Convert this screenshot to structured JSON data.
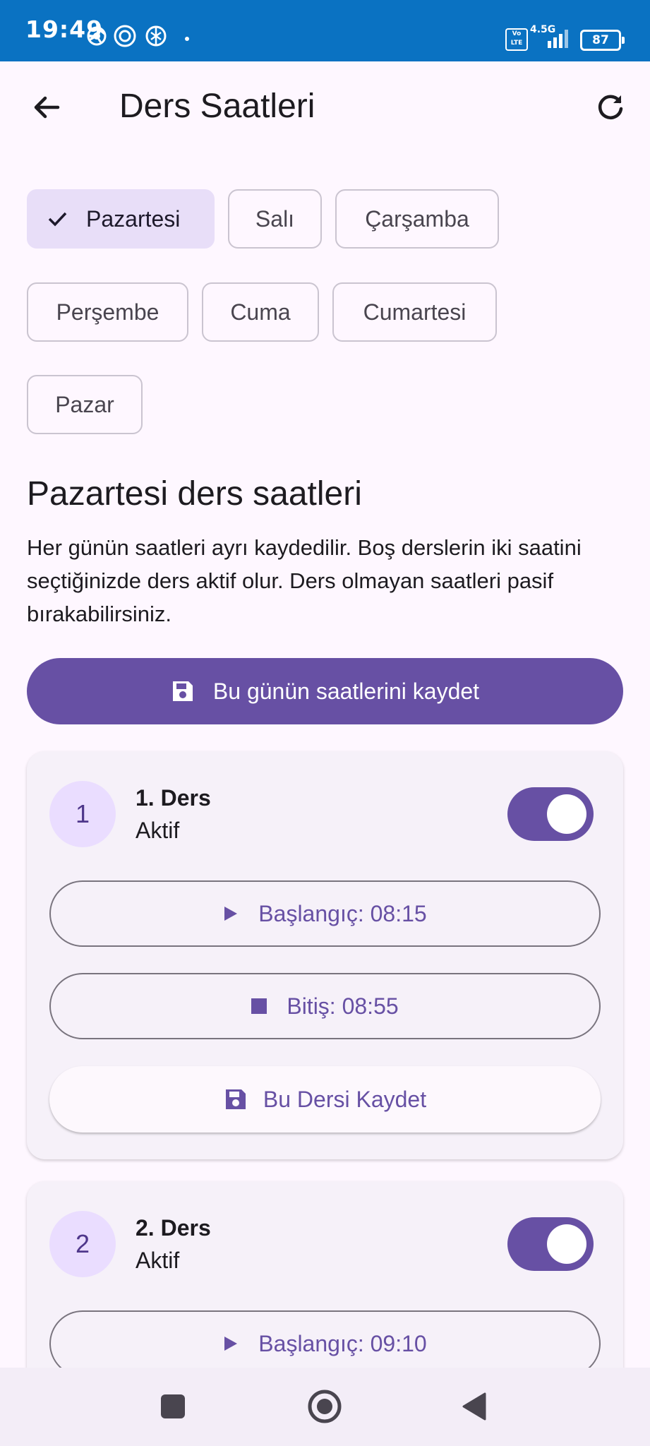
{
  "status_bar": {
    "time": "19:49",
    "network_type": "4.5G",
    "volte": "Vo LTE",
    "battery": "87"
  },
  "app_bar": {
    "title": "Ders Saatleri",
    "back_icon": "arrow-back-icon",
    "refresh_icon": "refresh-icon"
  },
  "days": [
    {
      "label": "Pazartesi",
      "selected": true
    },
    {
      "label": "Salı",
      "selected": false
    },
    {
      "label": "Çarşamba",
      "selected": false
    },
    {
      "label": "Perşembe",
      "selected": false
    },
    {
      "label": "Cuma",
      "selected": false
    },
    {
      "label": "Cumartesi",
      "selected": false
    },
    {
      "label": "Pazar",
      "selected": false
    }
  ],
  "section": {
    "title": "Pazartesi ders saatleri",
    "description": "Her günün saatleri ayrı kaydedilir. Boş derslerin iki saatini seçtiğinizde ders aktif olur. Ders olmayan saatleri pasif bırakabilirsiniz."
  },
  "save_day_button": "Bu günün saatlerini kaydet",
  "lessons": [
    {
      "number": "1",
      "title": "1. Ders",
      "status": "Aktif",
      "active": true,
      "start_label": "Başlangıç: 08:15",
      "end_label": "Bitiş: 08:55",
      "save_label": "Bu Dersi Kaydet"
    },
    {
      "number": "2",
      "title": "2. Ders",
      "status": "Aktif",
      "active": true,
      "start_label": "Başlangıç: 09:10"
    }
  ],
  "colors": {
    "status_bar": "#0A72C2",
    "primary": "#6750A4",
    "background": "#FEF7FF",
    "chip_selected": "#E8DEF8"
  },
  "nav_bar": {
    "recents_icon": "square-icon",
    "home_icon": "circle-home-icon",
    "back_icon": "triangle-back-icon"
  }
}
